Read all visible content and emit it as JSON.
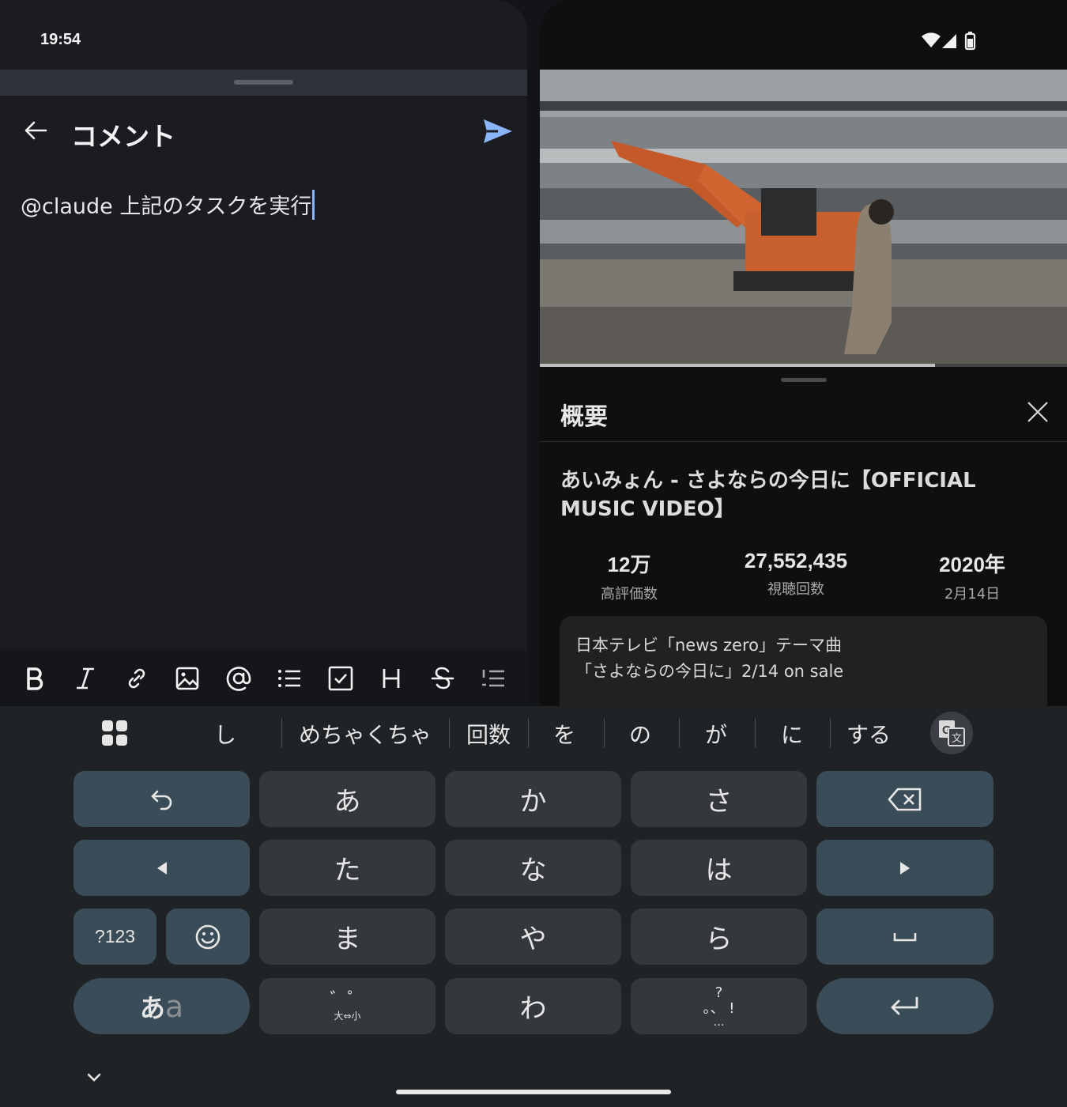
{
  "status_bar": {
    "time": "19:54"
  },
  "comment_editor": {
    "title": "コメント",
    "input_text": "@claude 上記のタスクを実行"
  },
  "format_toolbar": [
    "bold",
    "italic",
    "link",
    "image",
    "mention",
    "bullet-list",
    "checkbox",
    "heading",
    "strikethrough",
    "numbered-list"
  ],
  "description_panel": {
    "title": "概要",
    "video_title": "あいみょん - さよならの今日に【OFFICIAL MUSIC VIDEO】",
    "stats": [
      {
        "value": "12万",
        "label": "高評価数"
      },
      {
        "value": "27,552,435",
        "label": "視聴回数"
      },
      {
        "value": "2020年",
        "label": "2月14日"
      }
    ],
    "description_line1": "日本テレビ「news zero」テーマ曲",
    "description_line2": "「さよならの今日に」2/14 on sale",
    "progress_fraction": 0.75
  },
  "keyboard": {
    "suggestions": [
      "し",
      "めちゃくちゃ",
      "回数",
      "を",
      "の",
      "が",
      "に",
      "する"
    ],
    "keys": {
      "a": "あ",
      "ka": "か",
      "sa": "さ",
      "ta": "た",
      "na": "な",
      "ha": "は",
      "ma": "ま",
      "ya": "や",
      "ra": "ら",
      "wa": "わ",
      "sym": "?123",
      "mode_hira": "あ",
      "mode_latin": "a",
      "dakuten_top": "゛゜",
      "dakuten_bottom": "大⇔小",
      "punct_top": "?",
      "punct_mid": "。、 !",
      "punct_bottom": "…"
    }
  },
  "colors": {
    "accent": "#8ab4f8",
    "key_fn": "#3a4c57",
    "key": "#34373b"
  }
}
